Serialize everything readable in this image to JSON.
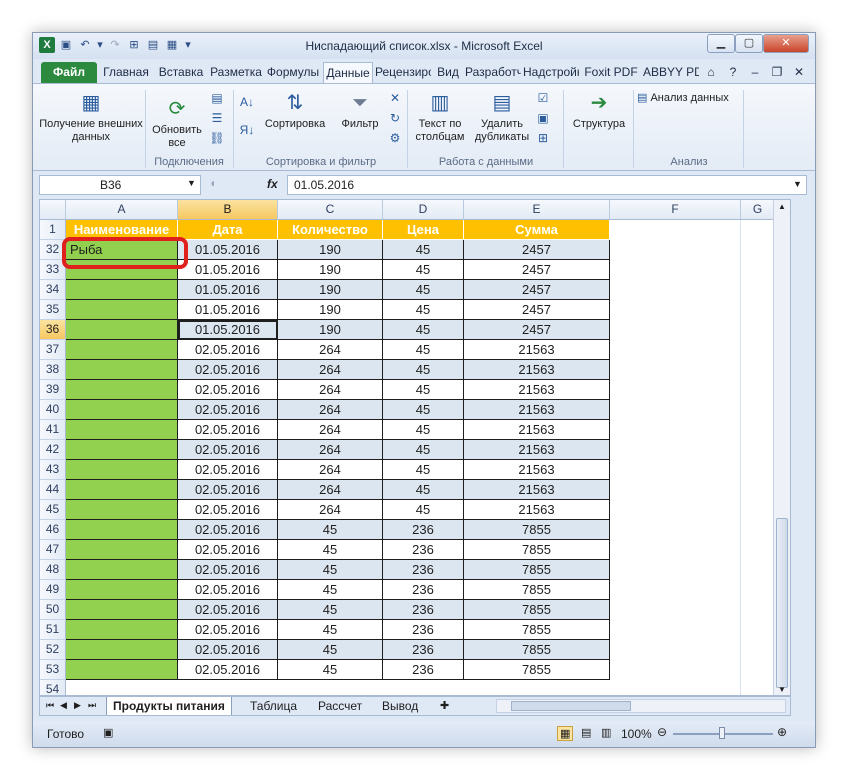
{
  "window": {
    "title": "Ниспадающий список.xlsx - Microsoft Excel"
  },
  "quick_access": {
    "logo": "X"
  },
  "ribbon_tabs": [
    "Файл",
    "Главная",
    "Вставка",
    "Разметка",
    "Формулы",
    "Данные",
    "Рецензирование",
    "Вид",
    "Разработчик",
    "Надстройки",
    "Foxit PDF",
    "ABBYY PDF"
  ],
  "ribbon": {
    "get_external": "Получение внешних данных",
    "refresh_all": "Обновить все",
    "sort": "Сортировка",
    "filter": "Фильтр",
    "text_to_cols": "Текст по столбцам",
    "remove_dupes": "Удалить дубликаты",
    "outline": "Структура",
    "data_analysis": "Анализ данных",
    "group_connections": "Подключения",
    "group_sort_filter": "Сортировка и фильтр",
    "group_data_tools": "Работа с данными",
    "group_analysis": "Анализ"
  },
  "formula_bar": {
    "name_box": "B36",
    "fx": "fx",
    "value": "01.05.2016"
  },
  "sheet": {
    "columns": [
      "A",
      "B",
      "C",
      "D",
      "E",
      "F",
      "G"
    ],
    "header_row_num": "1",
    "headers": [
      "Наименование",
      "Дата",
      "Количество",
      "Цена",
      "Сумма"
    ],
    "rows": [
      {
        "n": "32",
        "a": "Рыба",
        "b": "01.05.2016",
        "c": "190",
        "d": "45",
        "e": "2457"
      },
      {
        "n": "33",
        "a": "",
        "b": "01.05.2016",
        "c": "190",
        "d": "45",
        "e": "2457"
      },
      {
        "n": "34",
        "a": "",
        "b": "01.05.2016",
        "c": "190",
        "d": "45",
        "e": "2457"
      },
      {
        "n": "35",
        "a": "",
        "b": "01.05.2016",
        "c": "190",
        "d": "45",
        "e": "2457"
      },
      {
        "n": "36",
        "a": "",
        "b": "01.05.2016",
        "c": "190",
        "d": "45",
        "e": "2457"
      },
      {
        "n": "37",
        "a": "",
        "b": "02.05.2016",
        "c": "264",
        "d": "45",
        "e": "21563"
      },
      {
        "n": "38",
        "a": "",
        "b": "02.05.2016",
        "c": "264",
        "d": "45",
        "e": "21563"
      },
      {
        "n": "39",
        "a": "",
        "b": "02.05.2016",
        "c": "264",
        "d": "45",
        "e": "21563"
      },
      {
        "n": "40",
        "a": "",
        "b": "02.05.2016",
        "c": "264",
        "d": "45",
        "e": "21563"
      },
      {
        "n": "41",
        "a": "",
        "b": "02.05.2016",
        "c": "264",
        "d": "45",
        "e": "21563"
      },
      {
        "n": "42",
        "a": "",
        "b": "02.05.2016",
        "c": "264",
        "d": "45",
        "e": "21563"
      },
      {
        "n": "43",
        "a": "",
        "b": "02.05.2016",
        "c": "264",
        "d": "45",
        "e": "21563"
      },
      {
        "n": "44",
        "a": "",
        "b": "02.05.2016",
        "c": "264",
        "d": "45",
        "e": "21563"
      },
      {
        "n": "45",
        "a": "",
        "b": "02.05.2016",
        "c": "264",
        "d": "45",
        "e": "21563"
      },
      {
        "n": "46",
        "a": "",
        "b": "02.05.2016",
        "c": "45",
        "d": "236",
        "e": "7855"
      },
      {
        "n": "47",
        "a": "",
        "b": "02.05.2016",
        "c": "45",
        "d": "236",
        "e": "7855"
      },
      {
        "n": "48",
        "a": "",
        "b": "02.05.2016",
        "c": "45",
        "d": "236",
        "e": "7855"
      },
      {
        "n": "49",
        "a": "",
        "b": "02.05.2016",
        "c": "45",
        "d": "236",
        "e": "7855"
      },
      {
        "n": "50",
        "a": "",
        "b": "02.05.2016",
        "c": "45",
        "d": "236",
        "e": "7855"
      },
      {
        "n": "51",
        "a": "",
        "b": "02.05.2016",
        "c": "45",
        "d": "236",
        "e": "7855"
      },
      {
        "n": "52",
        "a": "",
        "b": "02.05.2016",
        "c": "45",
        "d": "236",
        "e": "7855"
      },
      {
        "n": "53",
        "a": "",
        "b": "02.05.2016",
        "c": "45",
        "d": "236",
        "e": "7855"
      }
    ],
    "last_row_num": "54",
    "selected_row": "36"
  },
  "sheet_tabs": [
    "Продукты питания",
    "Таблица",
    "Рассчет",
    "Вывод"
  ],
  "status": {
    "ready": "Готово",
    "zoom": "100%"
  },
  "colors": {
    "header_fill": "#ffc000",
    "name_fill": "#92d050",
    "alt_row": "#dce6f1",
    "callout": "#e0201d"
  }
}
